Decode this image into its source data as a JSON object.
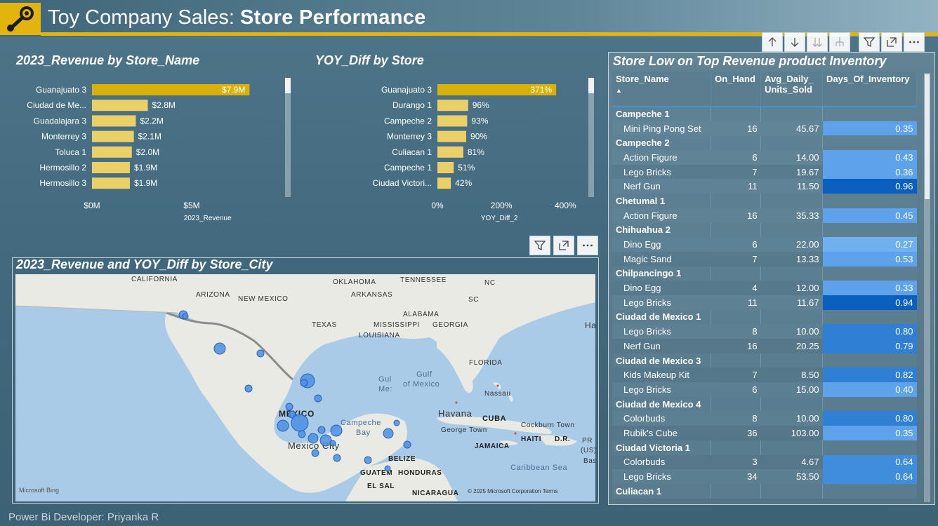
{
  "header": {
    "title_prefix": "Toy Company Sales: ",
    "title_bold": "Store Performance"
  },
  "colors": {
    "accent": "#e2b40d",
    "bar_highlight": "#d9b10a",
    "bar": "#ead066",
    "map_water": "#a9cbe8",
    "map_land": "#e9e9e4",
    "bubble": "#4a8fe3",
    "doi_dark": "#0a5fbf",
    "doi_mid": "#2f7fd4",
    "doi_light": "#5da2ea"
  },
  "chart_data": [
    {
      "type": "bar",
      "orientation": "horizontal",
      "title": "2023_Revenue by Store_Name",
      "categories": [
        "Guanajuato 3",
        "Ciudad de Me...",
        "Guadalajara 3",
        "Monterrey 3",
        "Toluca 1",
        "Hermosillo 2",
        "Hermosillo 3"
      ],
      "values": [
        7.9,
        2.8,
        2.2,
        2.1,
        2.0,
        1.9,
        1.9
      ],
      "data_labels": [
        "$7.9M",
        "$2.8M",
        "$2.2M",
        "$2.1M",
        "$2.0M",
        "$1.9M",
        "$1.9M"
      ],
      "xlim": [
        0,
        10
      ],
      "x_ticks": [
        0,
        5
      ],
      "x_tick_labels": [
        "$0M",
        "$5M"
      ],
      "xlabel": "2023_Revenue",
      "ylabel": ""
    },
    {
      "type": "bar",
      "orientation": "horizontal",
      "title": "YOY_Diff by Store",
      "categories": [
        "Guanajuato 3",
        "Durango 1",
        "Campeche 2",
        "Monterrey 3",
        "Culiacan 1",
        "Campeche 1",
        "Ciudad Victori..."
      ],
      "values": [
        371,
        96,
        93,
        90,
        81,
        51,
        42
      ],
      "data_labels": [
        "371%",
        "96%",
        "93%",
        "90%",
        "81%",
        "51%",
        "42%"
      ],
      "xlim": [
        0,
        430
      ],
      "x_ticks": [
        0,
        200,
        400
      ],
      "x_tick_labels": [
        "0%",
        "200%",
        "400%"
      ],
      "xlabel": "YOY_Diff_2",
      "ylabel": ""
    }
  ],
  "map": {
    "title": "2023_Revenue and YOY_Diff by Store_City",
    "labels": {
      "california": "CALIFORNIA",
      "arizona": "ARIZONA",
      "new_mexico": "NEW MEXICO",
      "oklahoma": "OKLAHOMA",
      "arkansas": "ARKANSAS",
      "tennessee": "TENNESSEE",
      "nc": "NC",
      "sc": "SC",
      "alabama": "ALABAMA",
      "mississippi": "MISSISSIPPI",
      "georgia": "GEORGIA",
      "texas": "TEXAS",
      "louisiana": "LOUISIANA",
      "florida": "FLORIDA",
      "gulf_mexico_1": "Gulf",
      "gulf_mexico_2": "of Mexico",
      "gulf_mexico_side": "Gul",
      "gulf_mexico_side2": "Me:",
      "mexico": "MEXICO",
      "mexico_city": "Mexico City",
      "campeche_bay_1": "Campeche",
      "campeche_bay_2": "Bay",
      "havana": "Havana",
      "nassau": "Nassau",
      "cuba": "CUBA",
      "george_town": "George Town",
      "cockburn_town": "Cockburn Town",
      "jamaica": "JAMAICA",
      "haiti": "HAITI",
      "dr": "D.R.",
      "pr": "PR",
      "us": "(US)",
      "caribbean_sea": "Caribbean Sea",
      "belize": "BELIZE",
      "guatemala": "GUATEM",
      "honduras": "HONDURAS",
      "el_salvador": "EL SAL",
      "nicaragua": "NICARAGUA",
      "ha": "Ha",
      "bas": "Bas",
      "attribution": "© 2025 Microsoft Corporation Terms",
      "bing": "Microsoft Bing"
    }
  },
  "table": {
    "title": "Store Low on Top Revenue product Inventory",
    "columns": [
      "Store_Name",
      "On_Hand",
      "Avg_Daily_\nUnits_Sold",
      "Days_Of_Inventory"
    ],
    "col_store": "Store_Name",
    "col_onhand": "On_Hand",
    "col_avg_1": "Avg_Daily_",
    "col_avg_2": "Units_Sold",
    "col_doi": "Days_Of_Inventory",
    "sort_indicator": "▲",
    "rows": [
      {
        "group": "Campeche 1"
      },
      {
        "name": "Mini Ping Pong Set",
        "on_hand": "16",
        "avg": "45.67",
        "doi": "0.35",
        "level": "light"
      },
      {
        "group": "Campeche 2"
      },
      {
        "name": "Action Figure",
        "on_hand": "6",
        "avg": "14.00",
        "doi": "0.43",
        "level": "light"
      },
      {
        "name": "Lego Bricks",
        "on_hand": "7",
        "avg": "19.67",
        "doi": "0.36",
        "level": "light"
      },
      {
        "name": "Nerf Gun",
        "on_hand": "11",
        "avg": "11.50",
        "doi": "0.96",
        "level": "dark"
      },
      {
        "group": "Chetumal 1"
      },
      {
        "name": "Action Figure",
        "on_hand": "16",
        "avg": "35.33",
        "doi": "0.45",
        "level": "light"
      },
      {
        "group": "Chihuahua 2"
      },
      {
        "name": "Dino Egg",
        "on_hand": "6",
        "avg": "22.00",
        "doi": "0.27",
        "level": "lighter"
      },
      {
        "name": "Magic Sand",
        "on_hand": "7",
        "avg": "13.33",
        "doi": "0.53",
        "level": "light"
      },
      {
        "group": "Chilpancingo 1"
      },
      {
        "name": "Dino Egg",
        "on_hand": "4",
        "avg": "12.00",
        "doi": "0.33",
        "level": "light"
      },
      {
        "name": "Lego Bricks",
        "on_hand": "11",
        "avg": "11.67",
        "doi": "0.94",
        "level": "dark"
      },
      {
        "group": "Ciudad de Mexico 1"
      },
      {
        "name": "Lego Bricks",
        "on_hand": "8",
        "avg": "10.00",
        "doi": "0.80",
        "level": "mid"
      },
      {
        "name": "Nerf Gun",
        "on_hand": "16",
        "avg": "20.25",
        "doi": "0.79",
        "level": "mid"
      },
      {
        "group": "Ciudad de Mexico 3"
      },
      {
        "name": "Kids Makeup Kit",
        "on_hand": "7",
        "avg": "8.50",
        "doi": "0.82",
        "level": "mid"
      },
      {
        "name": "Lego Bricks",
        "on_hand": "6",
        "avg": "15.00",
        "doi": "0.40",
        "level": "light"
      },
      {
        "group": "Ciudad de Mexico 4"
      },
      {
        "name": "Colorbuds",
        "on_hand": "8",
        "avg": "10.00",
        "doi": "0.80",
        "level": "mid"
      },
      {
        "name": "Rubik's Cube",
        "on_hand": "36",
        "avg": "103.00",
        "doi": "0.35",
        "level": "light"
      },
      {
        "group": "Ciudad Victoria 1"
      },
      {
        "name": "Colorbuds",
        "on_hand": "3",
        "avg": "4.67",
        "doi": "0.64",
        "level": "midlight"
      },
      {
        "name": "Lego Bricks",
        "on_hand": "34",
        "avg": "53.50",
        "doi": "0.64",
        "level": "midlight"
      },
      {
        "group": "Culiacan 1"
      }
    ]
  },
  "footer": "Power Bi Developer: Priyanka R"
}
